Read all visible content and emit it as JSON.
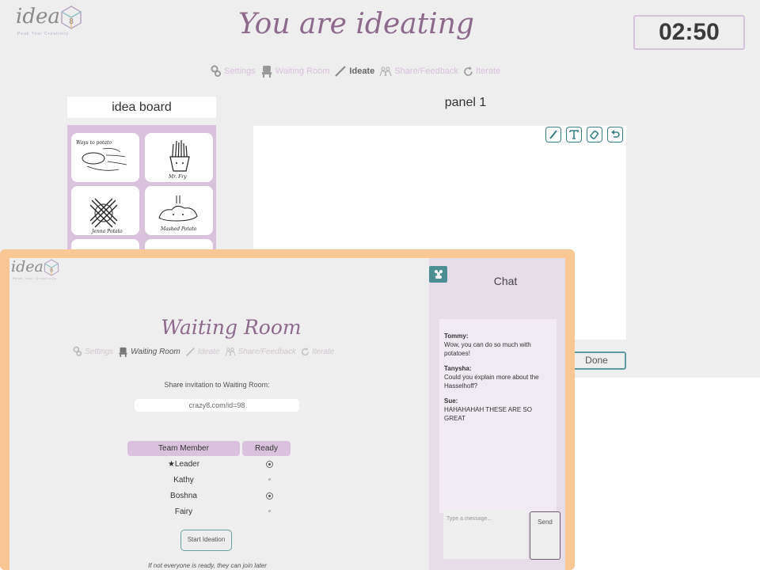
{
  "brand": {
    "word": "idea",
    "cube_number": "8",
    "tagline": "Peak Your Creativity"
  },
  "main": {
    "title": "You are ideating",
    "timer": "02:50",
    "steps": [
      {
        "label": "Settings",
        "icon": "gear-icon"
      },
      {
        "label": "Waiting Room",
        "icon": "chair-icon"
      },
      {
        "label": "Ideate",
        "icon": "pencil-icon",
        "active": true
      },
      {
        "label": "Share/Feedback",
        "icon": "people-icon"
      },
      {
        "label": "Iterate",
        "icon": "refresh-icon"
      }
    ],
    "idea_board": {
      "title": "idea board",
      "sketch_captions": [
        "Ways to potato",
        "Mr. Fry",
        "Jenna Potato",
        "Mashed Potato"
      ]
    },
    "panel": {
      "title": "panel 1",
      "tools": [
        "brush-icon",
        "text-icon",
        "eraser-icon",
        "undo-icon"
      ]
    },
    "done_label": "Done"
  },
  "waiting_room": {
    "title": "Waiting Room",
    "steps": [
      {
        "label": "Settings",
        "icon": "gear-icon"
      },
      {
        "label": "Waiting Room",
        "icon": "chair-icon",
        "active": true
      },
      {
        "label": "Ideate",
        "icon": "pencil-icon"
      },
      {
        "label": "Share/Feedback",
        "icon": "people-icon"
      },
      {
        "label": "Iterate",
        "icon": "refresh-icon"
      }
    ],
    "share_label": "Share invitation to Waiting Room:",
    "share_url": "crazy8.com/id=98",
    "table": {
      "headers": [
        "Team Member",
        "Ready"
      ],
      "rows": [
        {
          "name": "★Leader",
          "ready": true
        },
        {
          "name": "Kathy",
          "ready": false
        },
        {
          "name": "Boshna",
          "ready": true
        },
        {
          "name": "Fairy",
          "ready": false
        }
      ]
    },
    "start_label": "Start Ideation",
    "hint": "If not everyone is ready, they can join later"
  },
  "chat": {
    "title": "Chat",
    "messages": [
      {
        "author": "Tommy:",
        "text": "Wow, you can do so much with potatoes!"
      },
      {
        "author": "Tanysha:",
        "text": "Could you explain more about the Hasselhoff?"
      },
      {
        "author": "Sue:",
        "text": "HAHAHAHAH THESE ARE SO GREAT"
      }
    ],
    "input_placeholder": "Type a message...",
    "send_label": "Send"
  },
  "colors": {
    "accent_purple": "#8d6a8c",
    "lilac": "#d9c3dc",
    "teal": "#4d8e94",
    "frame_orange": "#f8c794"
  }
}
